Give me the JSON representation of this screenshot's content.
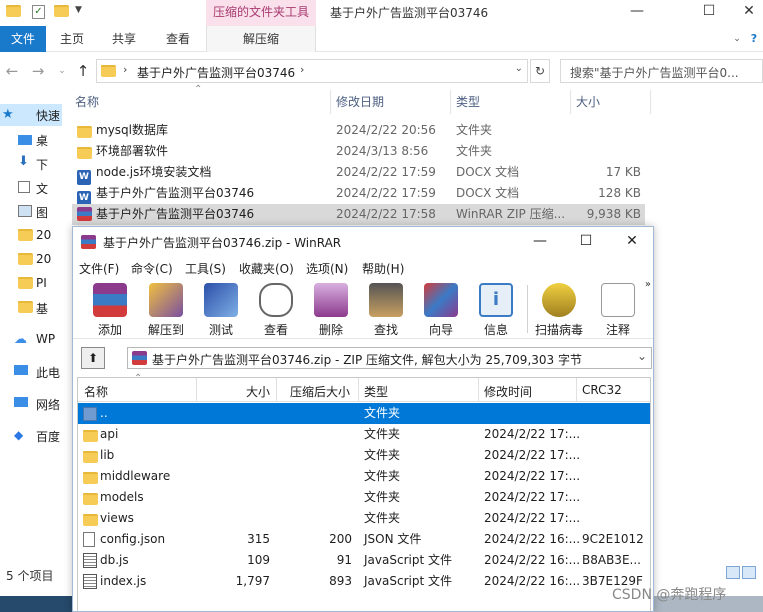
{
  "explorer": {
    "ribbon_context_header": "压缩的文件夹工具",
    "window_title": "基于户外广告监测平台03746",
    "tabs": {
      "file": "文件",
      "home": "主页",
      "share": "共享",
      "view": "查看",
      "extract": "解压缩"
    },
    "address": "基于户外广告监测平台03746",
    "search_placeholder": "搜索\"基于户外广告监测平台0...",
    "nav_items": [
      {
        "label": "快速",
        "icon": "star-icon",
        "selected": true
      },
      {
        "label": "桌",
        "icon": "desktop-icon"
      },
      {
        "label": "下",
        "icon": "download-icon"
      },
      {
        "label": "文",
        "icon": "document-icon"
      },
      {
        "label": "图",
        "icon": "picture-icon"
      },
      {
        "label": "20",
        "icon": "folder-icon"
      },
      {
        "label": "20",
        "icon": "folder-icon"
      },
      {
        "label": "PI",
        "icon": "folder-icon"
      },
      {
        "label": "基",
        "icon": "folder-icon"
      },
      {
        "label": "WP",
        "icon": "cloud-icon"
      },
      {
        "label": "此电",
        "icon": "computer-icon"
      },
      {
        "label": "网络",
        "icon": "network-icon"
      },
      {
        "label": "百度",
        "icon": "baidu-icon"
      }
    ],
    "columns": {
      "name": "名称",
      "date": "修改日期",
      "type": "类型",
      "size": "大小"
    },
    "files": [
      {
        "name": "mysql数据库",
        "date": "2024/2/22 20:56",
        "type": "文件夹",
        "size": "",
        "icon": "folder-icon"
      },
      {
        "name": "环境部署软件",
        "date": "2024/3/13 8:56",
        "type": "文件夹",
        "size": "",
        "icon": "folder-icon"
      },
      {
        "name": "node.js环境安装文档",
        "date": "2024/2/22 17:59",
        "type": "DOCX 文档",
        "size": "17 KB",
        "icon": "word-doc-icon"
      },
      {
        "name": "基于户外广告监测平台03746",
        "date": "2024/2/22 17:59",
        "type": "DOCX 文档",
        "size": "128 KB",
        "icon": "word-doc-icon"
      },
      {
        "name": "基于户外广告监测平台03746",
        "date": "2024/2/22 17:58",
        "type": "WinRAR ZIP 压缩...",
        "size": "9,938 KB",
        "icon": "winrar-archive-icon"
      }
    ],
    "status": "5 个项目"
  },
  "winrar": {
    "title": "基于户外广告监测平台03746.zip - WinRAR",
    "menu": [
      "文件(F)",
      "命令(C)",
      "工具(S)",
      "收藏夹(O)",
      "选项(N)",
      "帮助(H)"
    ],
    "toolbar": [
      {
        "label": "添加",
        "icon": "add-archive-icon"
      },
      {
        "label": "解压到",
        "icon": "extract-to-icon"
      },
      {
        "label": "测试",
        "icon": "test-icon"
      },
      {
        "label": "查看",
        "icon": "view-icon"
      },
      {
        "label": "删除",
        "icon": "delete-icon"
      },
      {
        "label": "查找",
        "icon": "find-icon"
      },
      {
        "label": "向导",
        "icon": "wizard-icon"
      },
      {
        "label": "信息",
        "icon": "info-icon"
      },
      {
        "label": "扫描病毒",
        "icon": "virus-scan-icon"
      },
      {
        "label": "注释",
        "icon": "comment-icon"
      }
    ],
    "path": "基于户外广告监测平台03746.zip - ZIP 压缩文件, 解包大小为 25,709,303 字节",
    "columns": {
      "name": "名称",
      "size": "大小",
      "packed": "压缩后大小",
      "type": "类型",
      "modified": "修改时间",
      "crc": "CRC32"
    },
    "rows": [
      {
        "name": "..",
        "size": "",
        "packed": "",
        "type": "文件夹",
        "modified": "",
        "crc": "",
        "icon": "parent-dir-icon",
        "selected": true
      },
      {
        "name": "api",
        "size": "",
        "packed": "",
        "type": "文件夹",
        "modified": "2024/2/22 17:...",
        "crc": "",
        "icon": "folder-icon"
      },
      {
        "name": "lib",
        "size": "",
        "packed": "",
        "type": "文件夹",
        "modified": "2024/2/22 17:...",
        "crc": "",
        "icon": "folder-icon"
      },
      {
        "name": "middleware",
        "size": "",
        "packed": "",
        "type": "文件夹",
        "modified": "2024/2/22 17:...",
        "crc": "",
        "icon": "folder-icon"
      },
      {
        "name": "models",
        "size": "",
        "packed": "",
        "type": "文件夹",
        "modified": "2024/2/22 17:...",
        "crc": "",
        "icon": "folder-icon"
      },
      {
        "name": "views",
        "size": "",
        "packed": "",
        "type": "文件夹",
        "modified": "2024/2/22 17:...",
        "crc": "",
        "icon": "folder-icon"
      },
      {
        "name": "config.json",
        "size": "315",
        "packed": "200",
        "type": "JSON 文件",
        "modified": "2024/2/22 16:...",
        "crc": "9C2E1012",
        "icon": "json-file-icon"
      },
      {
        "name": "db.js",
        "size": "109",
        "packed": "91",
        "type": "JavaScript 文件",
        "modified": "2024/2/22 16:...",
        "crc": "B8AB3E...",
        "icon": "js-file-icon"
      },
      {
        "name": "index.js",
        "size": "1,797",
        "packed": "893",
        "type": "JavaScript 文件",
        "modified": "2024/2/22 16:...",
        "crc": "3B7E129F",
        "icon": "js-file-icon"
      }
    ]
  },
  "watermark": "CSDN @奔跑程序"
}
